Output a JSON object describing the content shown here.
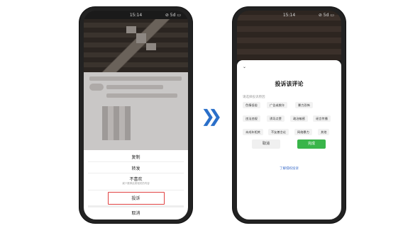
{
  "left_phone": {
    "status": {
      "time": "15:14",
      "signal": "⊘ 5d ▭"
    },
    "menu": {
      "copy": "复制",
      "forward": "转发",
      "dislike": "不喜欢",
      "dislike_sub": "减少推荐此类相关的内容",
      "complain": "投诉",
      "cancel": "取消"
    }
  },
  "right_phone": {
    "status": {
      "time": "15:14",
      "signal": "⊘ 5d ▭"
    },
    "title": "投诉该评论",
    "section": "请选择投诉原因",
    "chips": [
      "色情低俗",
      "广告或欺诈",
      "暴力恐怖",
      "违法违规",
      "诱导点赞",
      "政治敏感",
      "谣言传播",
      "未成年相关",
      "不友善言论",
      "网络暴力",
      "其他"
    ],
    "cancel": "取消",
    "done": "完成",
    "learn": "了解侵权投诉"
  },
  "arrow_glyph": "❯❯",
  "colors": {
    "accent_red": "#e04040",
    "green": "#39b54a",
    "link_blue": "#3b6cc9",
    "arrow_blue": "#2a6fc9"
  }
}
